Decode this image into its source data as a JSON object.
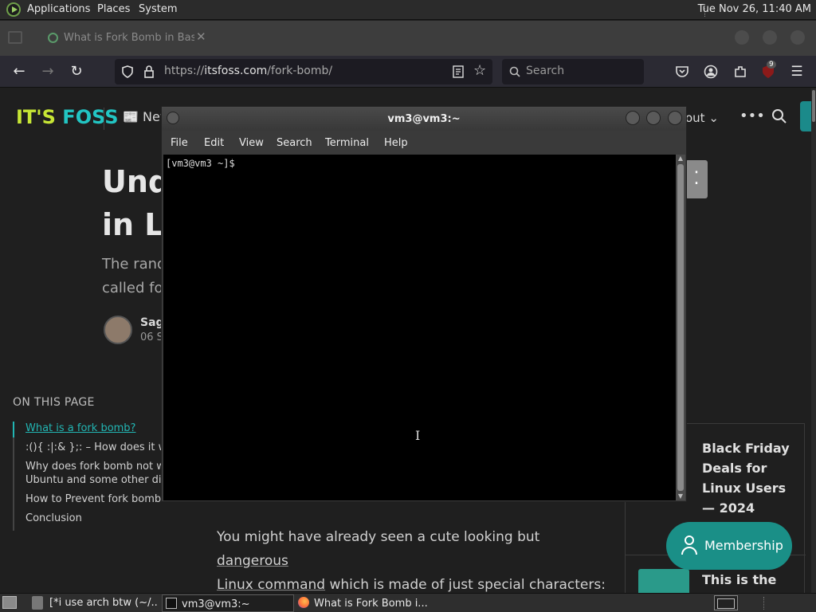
{
  "top_panel": {
    "menus": [
      "Applications",
      "Places",
      "System"
    ],
    "clock": "Tue Nov 26, 11:40 AM"
  },
  "browser": {
    "tab_title": "What is Fork Bomb in Bash?",
    "tab_close": "✕",
    "url_prefix": "https://",
    "url_domain": "itsfoss.com",
    "url_path": "/fork-bomb/",
    "search_placeholder": "Search",
    "ublock_count": "9"
  },
  "page": {
    "logo_its": "IT'S ",
    "logo_foss": "FOSS",
    "nav_news": "News",
    "nav_about": "out",
    "heading_line1": "Und",
    "heading_line2": "in Li",
    "subtitle_line1": "The rand",
    "subtitle_line2": "called fo",
    "author_name": "Sag",
    "author_date": "06 S",
    "toc_title": "ON THIS PAGE",
    "toc_items": [
      "What is a fork bomb?",
      ":(){ :|:& };: – How does it wo",
      "Why does fork bomb not w",
      "Ubuntu and some other dis",
      "How to Prevent fork bomb?",
      "Conclusion"
    ],
    "body_line1_a": "You might have already seen a cute looking but ",
    "body_line1_link": "dangerous",
    "body_line2_link": "Linux command",
    "body_line2_b": " which is made of just special characters:",
    "promo_title": "Black Friday Deals for Linux Users — 2024",
    "promo2_title": "This is the",
    "membership_label": "Membership"
  },
  "terminal": {
    "title": "vm3@vm3:~",
    "menu": [
      "File",
      "Edit",
      "View",
      "Search",
      "Terminal",
      "Help"
    ],
    "prompt": "[vm3@vm3 ~]$"
  },
  "taskbar": {
    "tasks": [
      "[*i use arch btw (~/...",
      "vm3@vm3:~",
      "What is Fork Bomb i..."
    ]
  },
  "colors": {
    "accent_teal": "#1a8f87",
    "logo_green": "#c7e635",
    "logo_cyan": "#22c5c3"
  }
}
